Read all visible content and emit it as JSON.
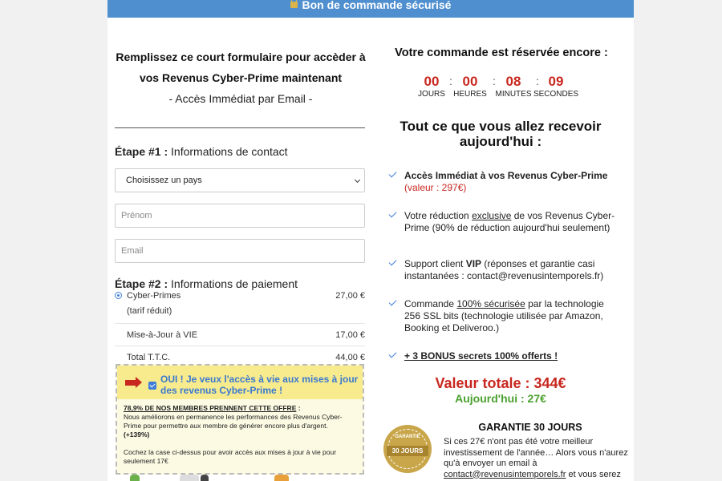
{
  "header": {
    "title": "Bon de commande sécurisé"
  },
  "intro": {
    "line1": "Remplissez ce court formulaire pour accèder à",
    "line2": "vos Revenus Cyber-Prime maintenant",
    "line3": "- Accès Immédiat par Email -"
  },
  "step1": {
    "label": "Étape #1 :",
    "title": "Informations de contact"
  },
  "form": {
    "country_value": "Choisissez un pays",
    "firstname_placeholder": "Prénom",
    "email_placeholder": "Email"
  },
  "step2": {
    "label": "Étape #2 :",
    "title": "Informations de paiement"
  },
  "products": [
    {
      "name": "Cyber-Primes",
      "note": "(tarif réduit)",
      "price": "27,00 €"
    },
    {
      "name": "Mise-à-Jour à VIE",
      "price": "17,00 €"
    },
    {
      "name": "Total T.T.C.",
      "price": "44,00 €"
    }
  ],
  "upsell": {
    "label": "OUI ! Je veux l'accès à vie aux mises à jour des revenus Cyber-Prime !",
    "heading": "78,9% DE NOS MEMBRES PRENNENT CETTE OFFRE",
    "heading_suffix": " :",
    "body": "Nous améliorons en permanence les performances des Revenus Cyber-Prime pour permettre aux membre de générer encore plus d'argent.",
    "boost": "(+139%)",
    "cta": "Cochez la case ci-dessus pour avoir accès aux mises à jour à vie pour seulement 17€"
  },
  "countdown": {
    "title": "Votre commande est réservée encore :",
    "days": "00",
    "hours": "00",
    "minutes": "08",
    "seconds": "09",
    "days_label": "JOURS",
    "hours_label": "HEURES",
    "minutes_label": "MINUTES",
    "seconds_label": "SECONDES",
    "sep": ":"
  },
  "receive": {
    "title": "Tout ce que vous allez recevoir aujourd'hui :"
  },
  "features": {
    "f1_bold": "Accès Immédiat à vos Revenus Cyber-Prime",
    "f1_value": "(valeur : 297€)",
    "f2_a": "Votre réduction ",
    "f2_u": "exclusive",
    "f2_b": " de vos Revenus Cyber-Prime (90% de réduction aujourd'hui seulement)",
    "f3_a": "Support client ",
    "f3_bold": "VIP",
    "f3_b": " (réponses et garantie casi instantanées : contact@revenusintemporels.fr)",
    "f4_a": "Commande ",
    "f4_u": "100% sécurisée",
    "f4_b": " par la technologie 256 SSL bits (technologie utilisée par Amazon, Booking et Deliveroo.)",
    "f5": "+ 3 BONUS secrets 100% offerts !"
  },
  "totals": {
    "value": "Valeur totale : 344€",
    "today": "Aujourd'hui : 27€"
  },
  "guarantee": {
    "seal_top": "GARANTIE",
    "seal_mid": "30 JOURS",
    "title": "GARANTIE 30 JOURS",
    "text_a": "Si ces 27€ n'ont pas été votre meilleur investissement de l'année… Alors vous n'aurez qu'à envoyer un email à ",
    "email": "contact@revenusintemporels.fr",
    "text_b": " et vous serez"
  },
  "colors": {
    "header": "#4f8fcf",
    "accent_red": "#c8271f",
    "accent_green": "#4aa12f",
    "link_blue": "#3a78d0",
    "offer_yellow": "#f7eb8e"
  }
}
